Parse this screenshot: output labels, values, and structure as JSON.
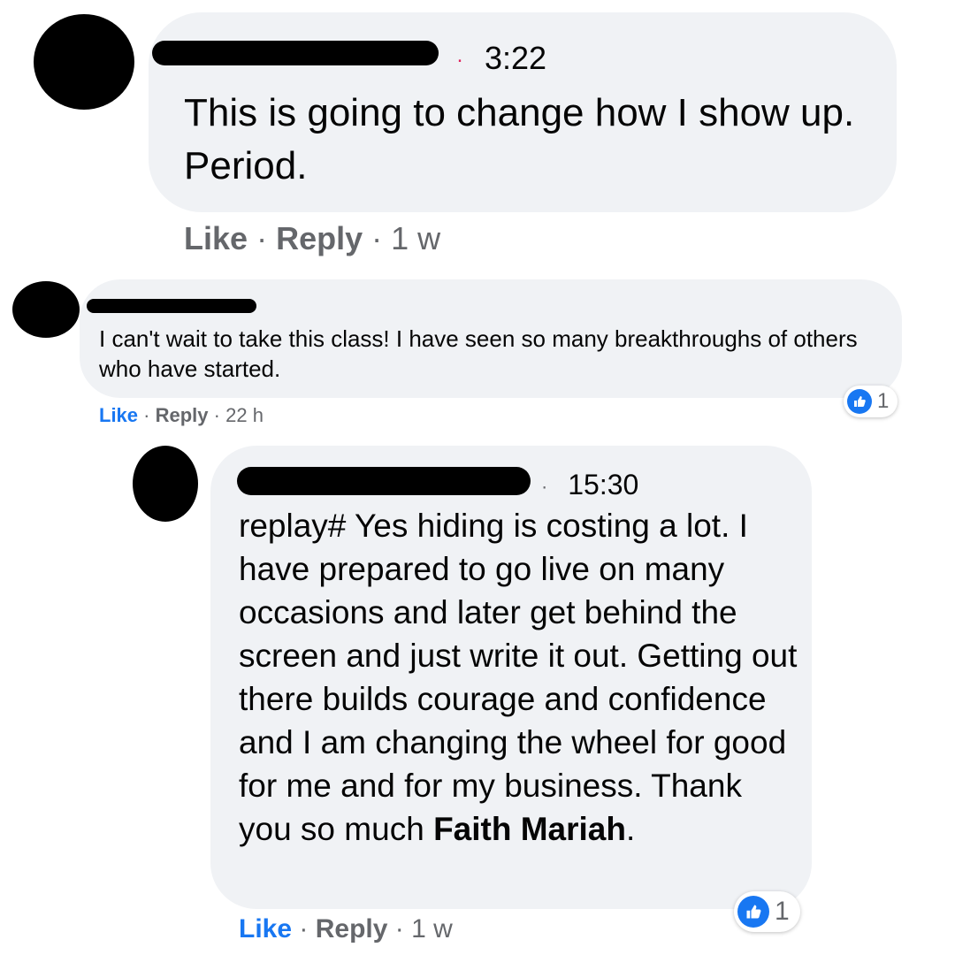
{
  "comments": [
    {
      "time": "3:22",
      "text": "This is going to change how I show up. Period.",
      "actions": {
        "like": "Like",
        "reply": "Reply",
        "age": "1 w",
        "sep": "·"
      }
    },
    {
      "text": "I can't wait to take this class! I have seen so many breakthroughs of others who have started.",
      "actions": {
        "like": "Like",
        "reply": "Reply",
        "age": "22 h",
        "sep": "·"
      },
      "reactions": {
        "count": "1",
        "icon": "like-icon"
      }
    },
    {
      "time": "15:30",
      "text": "replay# Yes hiding is costing a lot. I have prepared to go live on many occasions and later get behind the screen and just write it out. Getting out there builds courage and confidence and I am changing the wheel for good for me and for my business. Thank you so much",
      "mention": "Faith Mariah",
      "trailing": ".",
      "actions": {
        "like": "Like",
        "reply": "Reply",
        "age": "1 w",
        "sep": "·"
      },
      "reactions": {
        "count": "1",
        "icon": "like-icon"
      }
    }
  ],
  "colors": {
    "bubble": "#f0f2f5",
    "secondary_text": "#65676b",
    "link_blue": "#1877f2",
    "text": "#050505"
  }
}
